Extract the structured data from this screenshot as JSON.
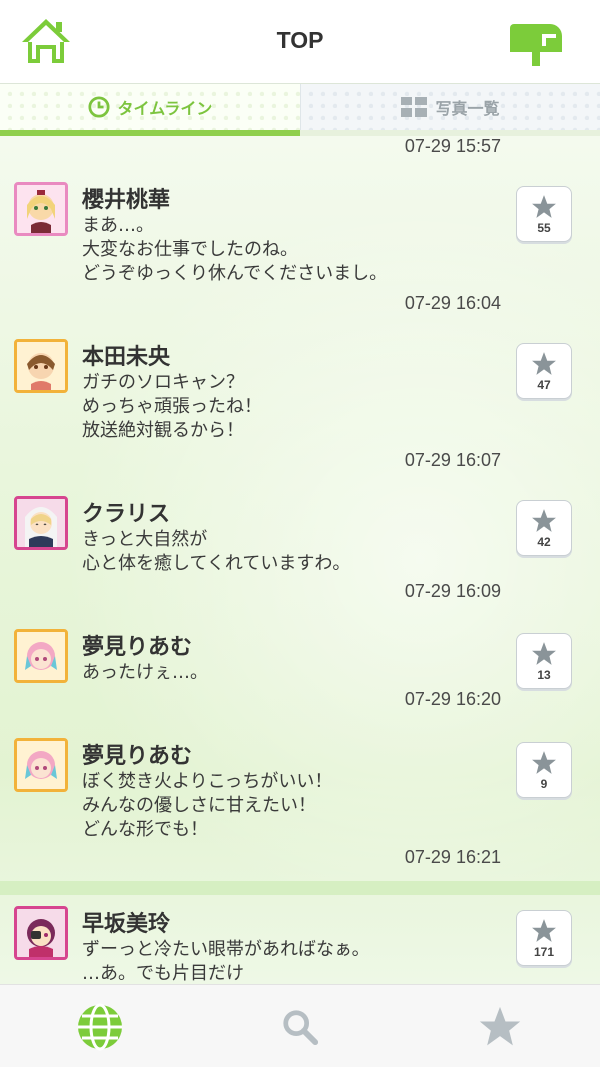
{
  "header": {
    "title": "TOP",
    "home_icon": "home-icon",
    "mail_icon": "mailbox-icon"
  },
  "tabs": [
    {
      "label": "タイムライン",
      "icon": "clock-icon",
      "active": true
    },
    {
      "label": "写真一覧",
      "icon": "grid-icon",
      "active": false
    }
  ],
  "feed": {
    "top_timestamp": "07-29 15:57",
    "posts": [
      {
        "name": "櫻井桃華",
        "lines": [
          "まあ…。",
          "大変なお仕事でしたのね。",
          "どうぞゆっくり休んでくださいまし。"
        ],
        "time": "07-29 16:04",
        "likes": "55"
      },
      {
        "name": "本田未央",
        "lines": [
          "ガチのソロキャン？",
          "めっちゃ頑張ったね！",
          "放送絶対観るから！"
        ],
        "time": "07-29 16:07",
        "likes": "47"
      },
      {
        "name": "クラリス",
        "lines": [
          "きっと大自然が",
          "心と体を癒してくれていますわ。"
        ],
        "time": "07-29 16:09",
        "likes": "42"
      },
      {
        "name": "夢見りあむ",
        "lines": [
          "あったけぇ…。"
        ],
        "time": "07-29 16:20",
        "likes": "13"
      },
      {
        "name": "夢見りあむ",
        "lines": [
          "ぼく焚き火よりこっちがいい！",
          "みんなの優しさに甘えたい！",
          "どんな形でも！"
        ],
        "time": "07-29 16:21",
        "likes": "9"
      },
      {
        "name": "早坂美玲",
        "lines": [
          "ずーっと冷たい眼帯があればなぁ。",
          "…あ。でも片目だけ"
        ],
        "time": "",
        "likes": "171"
      }
    ]
  },
  "bottom_nav": [
    {
      "icon": "globe-icon",
      "active": true
    },
    {
      "icon": "search-icon",
      "active": false
    },
    {
      "icon": "star-icon",
      "active": false
    }
  ],
  "colors": {
    "accent": "#8fcf4d",
    "tab_active_text": "#7cc43e",
    "inactive": "#b6bec3"
  }
}
